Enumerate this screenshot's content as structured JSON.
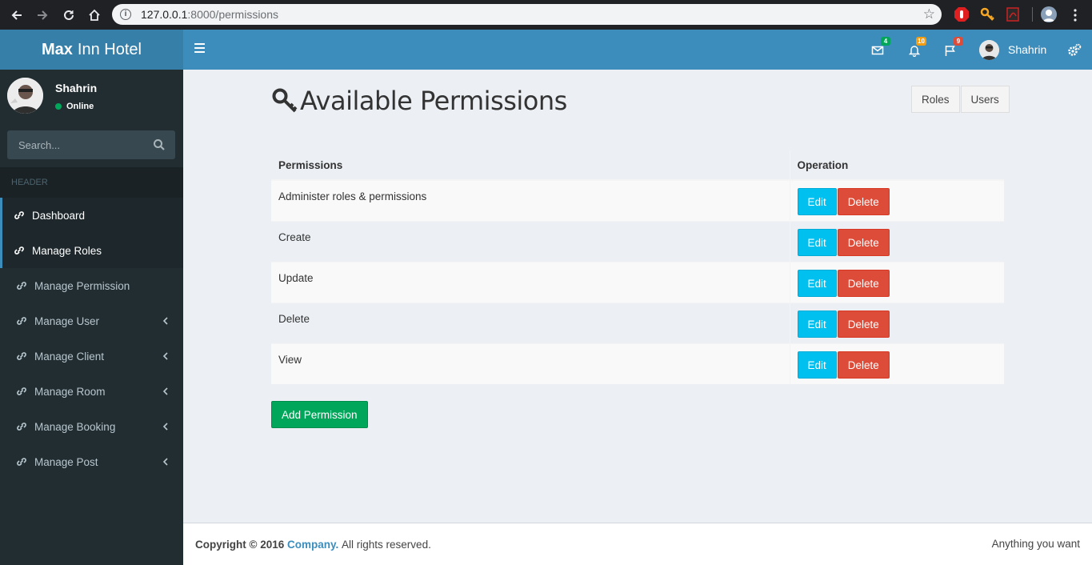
{
  "browser": {
    "url_host": "127.0.0.1",
    "url_rest": ":8000/permissions"
  },
  "header": {
    "logo_bold": "Max",
    "logo_rest": "Inn Hotel",
    "messages_count": "4",
    "notifications_count": "10",
    "tasks_count": "9",
    "user_name": "Shahrin",
    "colors": {
      "navbar": "#3c8dbc",
      "logo": "#367fa9",
      "green": "#00a65a",
      "yellow": "#f39c12",
      "red": "#dd4b39"
    }
  },
  "sidebar": {
    "user_name": "Shahrin",
    "status": "Online",
    "search_placeholder": "Search...",
    "header_label": "HEADER",
    "items": [
      {
        "label": "Dashboard",
        "icon": "link-icon",
        "active": true,
        "submenu": false
      },
      {
        "label": "Manage Roles",
        "icon": "link-icon",
        "active": true,
        "submenu": false
      },
      {
        "label": "Manage Permission",
        "icon": "link-icon",
        "active": false,
        "submenu": false
      },
      {
        "label": "Manage User",
        "icon": "link-icon",
        "active": false,
        "submenu": true
      },
      {
        "label": "Manage Client",
        "icon": "link-icon",
        "active": false,
        "submenu": true
      },
      {
        "label": "Manage Room",
        "icon": "link-icon",
        "active": false,
        "submenu": true
      },
      {
        "label": "Manage Booking",
        "icon": "link-icon",
        "active": false,
        "submenu": true
      },
      {
        "label": "Manage Post",
        "icon": "link-icon",
        "active": false,
        "submenu": true
      }
    ]
  },
  "main": {
    "title": "Available Permissions",
    "title_icon": "key-icon",
    "roles_button": "Roles",
    "users_button": "Users",
    "table": {
      "columns": [
        "Permissions",
        "Operation"
      ],
      "rows": [
        {
          "name": "Administer roles & permissions"
        },
        {
          "name": "Create"
        },
        {
          "name": "Update"
        },
        {
          "name": "Delete"
        },
        {
          "name": "View"
        }
      ],
      "edit_label": "Edit",
      "delete_label": "Delete"
    },
    "add_button": "Add Permission"
  },
  "footer": {
    "copyright_prefix": "Copyright © 2016",
    "company": "Company.",
    "rights": "All rights reserved.",
    "right_text": "Anything you want"
  }
}
